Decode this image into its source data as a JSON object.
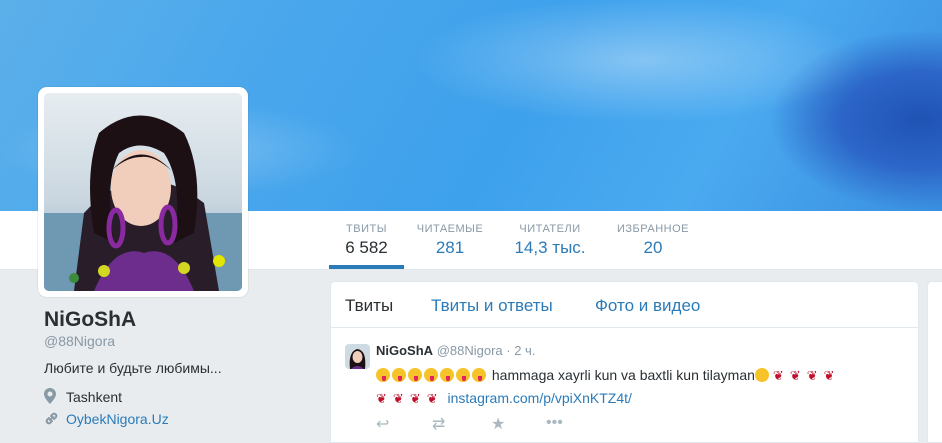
{
  "profile": {
    "name": "NiGoShA",
    "handle": "@88Nigora",
    "bio": "Любите и будьте любимы...",
    "location": "Tashkent",
    "website": "OybekNigora.Uz"
  },
  "stats": [
    {
      "label": "ТВИТЫ",
      "value": "6 582"
    },
    {
      "label": "ЧИТАЕМЫЕ",
      "value": "281"
    },
    {
      "label": "ЧИТАТЕЛИ",
      "value": "14,3 тыс."
    },
    {
      "label": "ИЗБРАННОЕ",
      "value": "20"
    }
  ],
  "timeline": {
    "tabs": [
      "Твиты",
      "Твиты и ответы",
      "Фото и видео"
    ],
    "tweet": {
      "name": "NiGoShA",
      "handle": "@88Nigora",
      "time": "· 2 ч.",
      "text": "hammaga xayrli kun va baxtli kun tilayman",
      "link": "instagram.com/p/vpiXnKTZ4t/"
    }
  },
  "colors": {
    "link": "#2b7bb9",
    "muted": "#8899a6",
    "banner": "#48a6ec"
  }
}
